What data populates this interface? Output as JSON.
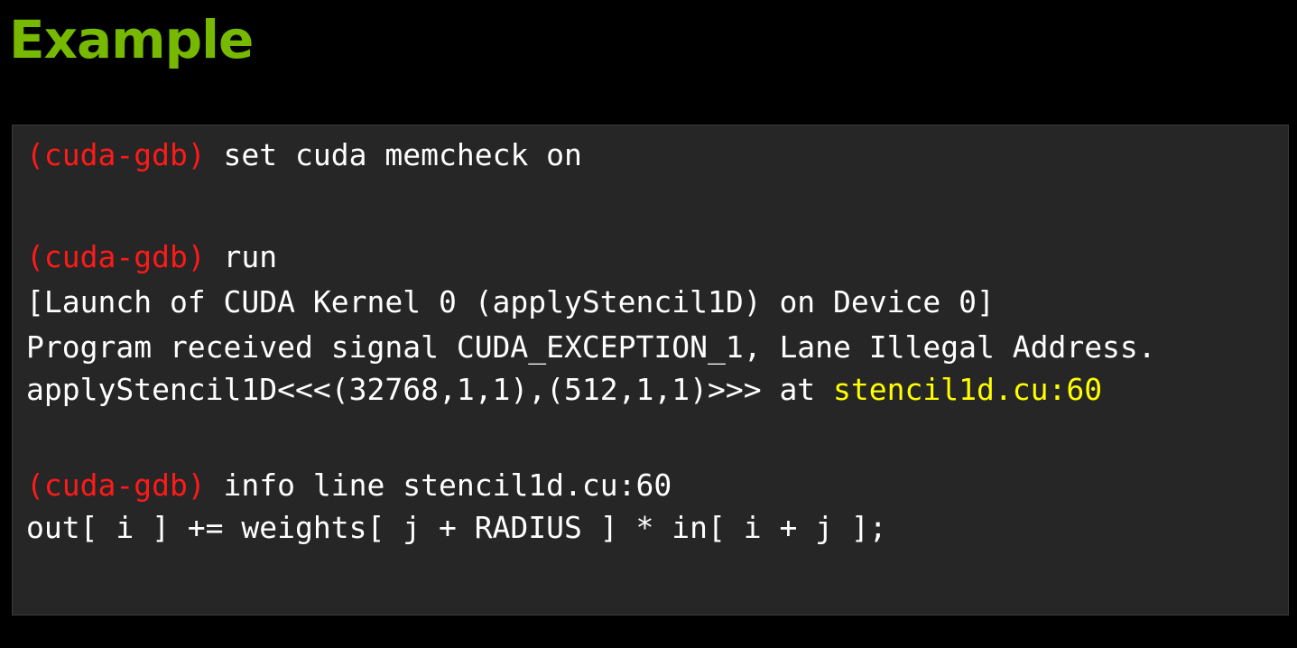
{
  "title": "Example",
  "terminal": {
    "prompt": "(cuda-gdb)",
    "cmd1": " set cuda memcheck on",
    "cmd2": " run",
    "launch_line": "[Launch of CUDA Kernel 0 (applyStencil1D) on Device 0]",
    "signal_line": "Program received signal CUDA_EXCEPTION_1, Lane Illegal Address.",
    "location_prefix": "applyStencil1D<<<(32768,1,1),(512,1,1)>>> at ",
    "location_file": "stencil1d.cu:60",
    "cmd3": " info line stencil1d.cu:60",
    "source_line": "out[ i ] += weights[ j + RADIUS ] * in[ i + j ];"
  },
  "colors": {
    "title": "#76b900",
    "prompt": "#ff1a1a",
    "file_link": "#ffff00",
    "text": "#ffffff",
    "terminal_bg": "#262626",
    "page_bg": "#000000"
  }
}
